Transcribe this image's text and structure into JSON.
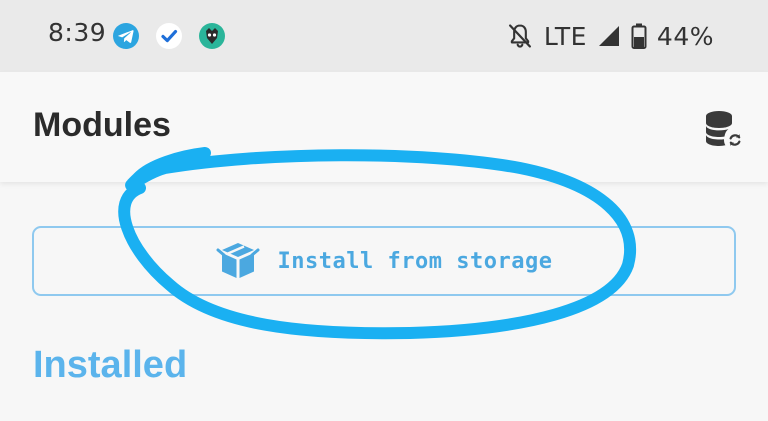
{
  "status_bar": {
    "time": "8:39",
    "notification_icons": [
      "telegram-icon",
      "checkmark-app-icon",
      "gecko-app-icon"
    ],
    "network": "LTE",
    "battery": "44%",
    "icons": [
      "notifications-off-icon",
      "signal-icon",
      "battery-icon"
    ]
  },
  "app_bar": {
    "title": "Modules",
    "action_icon": "database-sync-icon"
  },
  "install_button": {
    "label": "Install from storage",
    "icon": "package-icon"
  },
  "section": {
    "title": "Installed"
  },
  "colors": {
    "accent": "#4ba8e0",
    "section_title": "#5bb4ec",
    "annotation": "#1ab0f2",
    "telegram": "#2ca5e0",
    "gecko": "#2bb59a"
  }
}
